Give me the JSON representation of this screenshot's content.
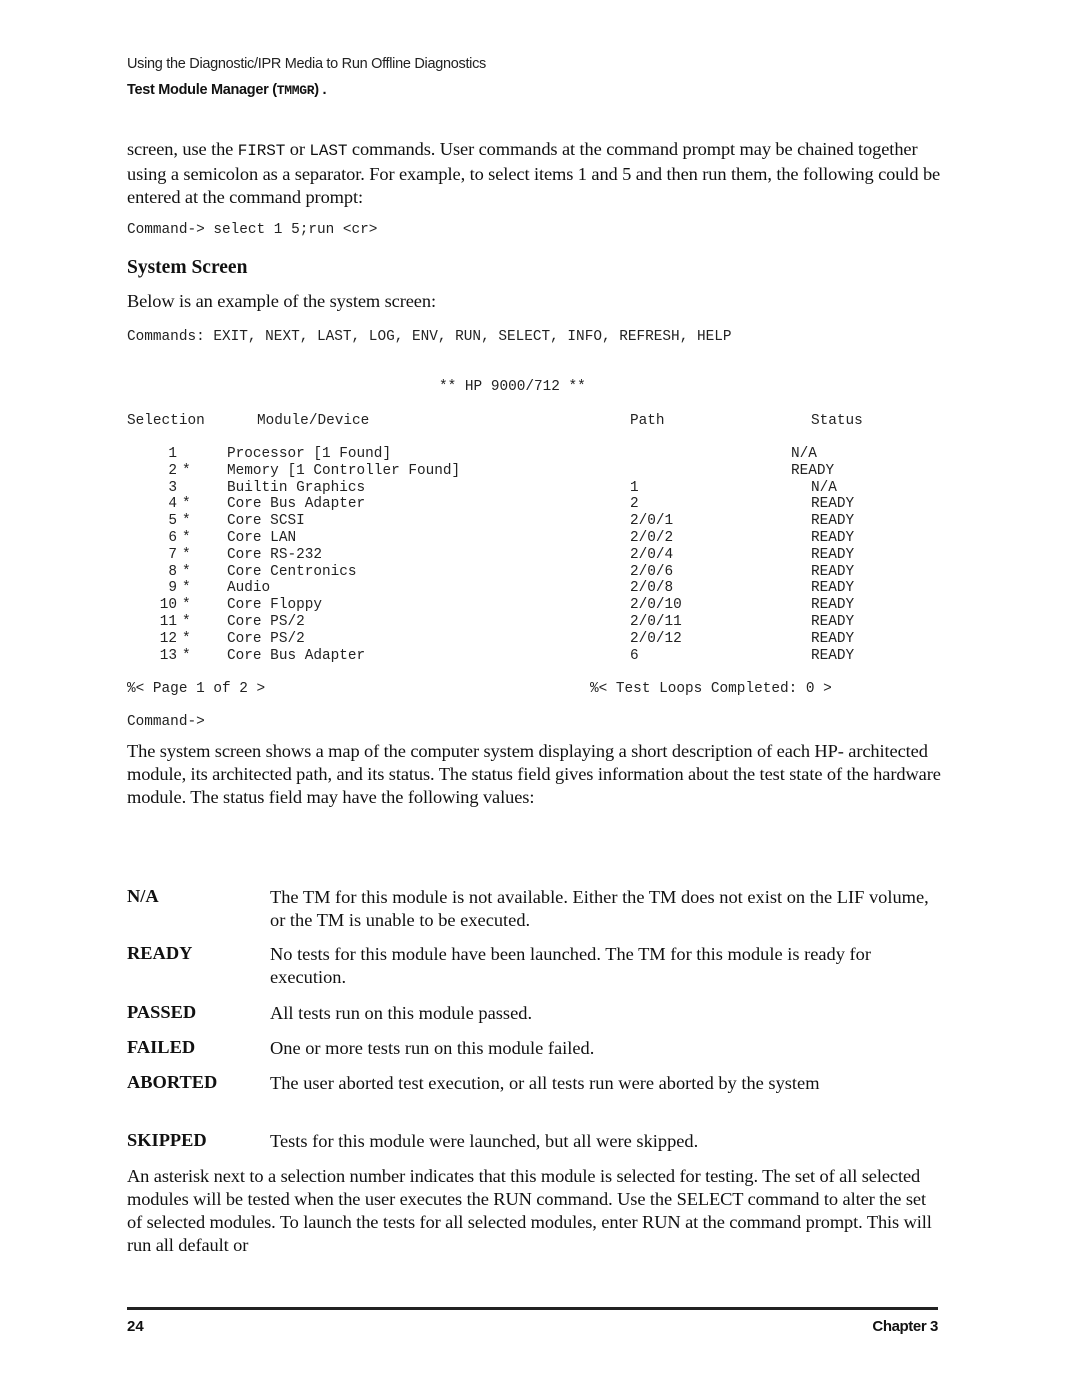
{
  "header": {
    "line1": "Using the Diagnostic/IPR Media to Run Offline Diagnostics",
    "line2_prefix": "Test Module Manager (",
    "line2_code": "TMMGR",
    "line2_suffix": ") ."
  },
  "intro": {
    "p1_a": "screen, use the ",
    "p1_first": "FIRST",
    "p1_b": " or ",
    "p1_last": "LAST",
    "p1_c": " commands. User commands at the command prompt may be chained together using a semicolon as a separator. For example, to select items 1 and 5 and then run them, the following could be entered at the command prompt:",
    "command_example": "Command-> select 1 5;run <cr>"
  },
  "section": {
    "title": "System Screen",
    "lead": "Below is an example of the system screen:"
  },
  "screen": {
    "commands": "Commands: EXIT, NEXT, LAST, LOG, ENV, RUN, SELECT, INFO, REFRESH, HELP",
    "system_title": "** HP 9000/712 **",
    "columns": {
      "selection": "Selection",
      "module": "Module/Device",
      "path": "Path",
      "status": "Status"
    },
    "rows": [
      {
        "num": "1",
        "selected": "",
        "module": "Processor [1 Found]",
        "path": "",
        "status": "N/A"
      },
      {
        "num": "2",
        "selected": "*",
        "module": "Memory [1 Controller Found]",
        "path": "",
        "status": "READY"
      },
      {
        "num": "3",
        "selected": "",
        "module": "Builtin Graphics",
        "path": "1",
        "status": "N/A"
      },
      {
        "num": "4",
        "selected": "*",
        "module": "Core Bus Adapter",
        "path": "2",
        "status": "READY"
      },
      {
        "num": "5",
        "selected": "*",
        "module": "Core SCSI",
        "path": "2/0/1",
        "status": "READY"
      },
      {
        "num": "6",
        "selected": "*",
        "module": "Core LAN",
        "path": "2/0/2",
        "status": "READY"
      },
      {
        "num": "7",
        "selected": "*",
        "module": "Core RS-232",
        "path": "2/0/4",
        "status": "READY"
      },
      {
        "num": "8",
        "selected": "*",
        "module": "Core Centronics",
        "path": "2/0/6",
        "status": "READY"
      },
      {
        "num": "9",
        "selected": "*",
        "module": "Audio",
        "path": "2/0/8",
        "status": "READY"
      },
      {
        "num": "10",
        "selected": "*",
        "module": "Core Floppy",
        "path": "2/0/10",
        "status": "READY"
      },
      {
        "num": "11",
        "selected": "*",
        "module": "Core PS/2",
        "path": "2/0/11",
        "status": "READY"
      },
      {
        "num": "12",
        "selected": "*",
        "module": "Core PS/2",
        "path": "2/0/12",
        "status": "READY"
      },
      {
        "num": "13",
        "selected": "*",
        "module": "Core Bus Adapter",
        "path": "6",
        "status": "READY"
      }
    ],
    "page_indicator": "%< Page 1 of 2 >",
    "loops_indicator": "%< Test Loops Completed: 0 >",
    "prompt": "Command->"
  },
  "body": {
    "p2": "The system screen shows a map of the computer system displaying a short description of each HP- architected module, its architected path, and its status. The status field gives information about the test state of the hardware module. The status field may have the following values:",
    "status_values": [
      {
        "term": "N/A",
        "definition": "The TM for this module is not available. Either the TM does not exist on the LIF volume, or the TM is unable to be executed."
      },
      {
        "term": "READY",
        "definition": "No tests for this module have been launched. The TM for this module is ready for execution."
      },
      {
        "term": "PASSED",
        "definition": "All tests run on this module passed."
      },
      {
        "term": "FAILED",
        "definition": "One or more tests run on this module failed."
      },
      {
        "term": "ABORTED",
        "definition": "The user aborted test execution, or all tests run were aborted by the system"
      },
      {
        "term": "SKIPPED",
        "definition": "Tests for this module were launched, but all were skipped."
      }
    ],
    "p3": "An asterisk next to a selection number indicates that this module is selected for testing. The set of all selected modules will be tested when the user executes the RUN command. Use the SELECT command to alter the set of selected modules. To launch the tests for all selected modules, enter RUN at the command prompt. This will run all default or"
  },
  "footer": {
    "page_number": "24",
    "chapter": "Chapter 3"
  }
}
